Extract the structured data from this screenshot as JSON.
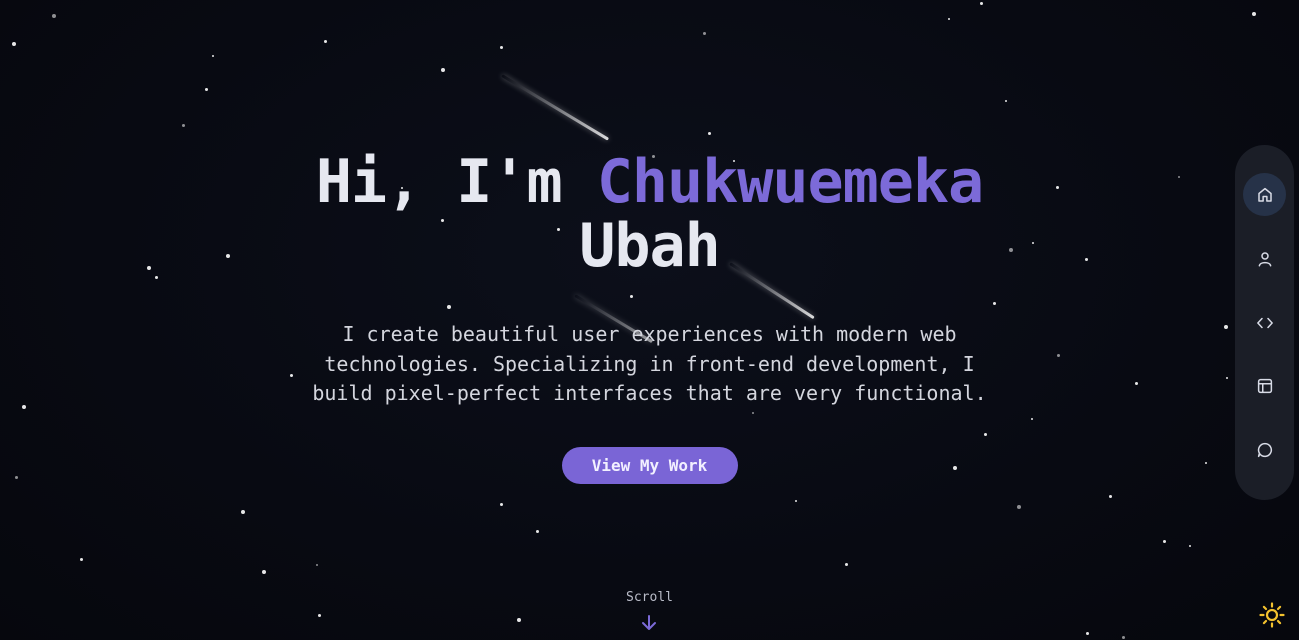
{
  "hero": {
    "greeting": "Hi, I'm",
    "name_first": "Chukwuemeka",
    "name_last": "Ubah",
    "intro": "I create beautiful user experiences with modern web technologies. Specializing in front-end development, I build pixel-perfect interfaces that are very functional.",
    "cta_label": "View My Work"
  },
  "scroll": {
    "label": "Scroll",
    "icon": "arrow-down-icon"
  },
  "dock": {
    "items": [
      {
        "icon": "home-icon",
        "active": true
      },
      {
        "icon": "user-icon",
        "active": false
      },
      {
        "icon": "code-icon",
        "active": false
      },
      {
        "icon": "layout-icon",
        "active": false
      },
      {
        "icon": "message-icon",
        "active": false
      }
    ]
  },
  "theme_toggle": {
    "icon": "sun-icon"
  },
  "colors": {
    "background": "#080a12",
    "accent": "#7c6ad8",
    "button": "#7a65d6",
    "dock": "#1b1e27",
    "dock_active": "#263248",
    "sun": "#f2c12e"
  }
}
